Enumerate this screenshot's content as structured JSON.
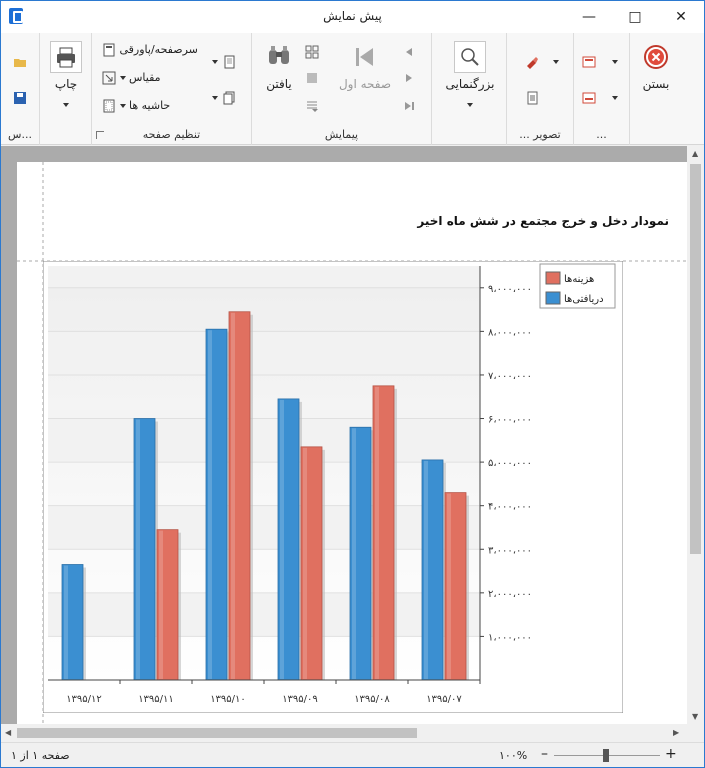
{
  "window": {
    "title": "پیش نمایش"
  },
  "ribbon": {
    "groups": {
      "close": {
        "close_label": "بستن"
      },
      "misc": {
        "label": "..."
      },
      "export": {
        "label": "... تصویر"
      },
      "zoom": {
        "zoom_label": "بزرگنمایی"
      },
      "navigation": {
        "label": "پیمایش",
        "first_page_label": "صفحه اول",
        "find_label": "یافتن"
      },
      "page_setup": {
        "label": "تنظیم صفحه",
        "header_footer_label": "سرصفحه/پاورقی",
        "scale_label": "مقیاس",
        "margins_label": "حاشیه ها"
      },
      "print": {
        "print_label": "چاپ"
      },
      "document": {
        "label": "س..."
      }
    }
  },
  "report": {
    "title": "نمودار دخل و خرج مجتمع در شش ماه اخیر"
  },
  "status": {
    "page_info": "صفحه ۱ از ۱",
    "zoom_value": "۱۰۰%"
  },
  "chart_data": {
    "type": "bar",
    "title": "",
    "xlabel": "",
    "ylabel": "",
    "categories": [
      "۱۳۹۵/۰۷",
      "۱۳۹۵/۰۸",
      "۱۳۹۵/۰۹",
      "۱۳۹۵/۱۰",
      "۱۳۹۵/۱۱",
      "۱۳۹۵/۱۲"
    ],
    "series": [
      {
        "name": "دریافتی‌ها",
        "color": "#3b8fd1",
        "values": [
          5050000,
          5800000,
          6450000,
          8050000,
          6000000,
          2650000
        ]
      },
      {
        "name": "هزینه‌ها",
        "color": "#e07060",
        "values": [
          4300000,
          6750000,
          5350000,
          8450000,
          3450000,
          0
        ]
      }
    ],
    "ylim": [
      0,
      9500000
    ],
    "yticks": [
      1000000,
      2000000,
      3000000,
      4000000,
      5000000,
      6000000,
      7000000,
      8000000,
      9000000
    ],
    "ytick_labels": [
      "۱،۰۰۰،۰۰۰",
      "۲،۰۰۰،۰۰۰",
      "۳،۰۰۰،۰۰۰",
      "۴،۰۰۰،۰۰۰",
      "۵،۰۰۰،۰۰۰",
      "۶،۰۰۰،۰۰۰",
      "۷،۰۰۰،۰۰۰",
      "۸،۰۰۰،۰۰۰",
      "۹،۰۰۰،۰۰۰"
    ],
    "y_axis_side": "right",
    "x_order": "right-to-left",
    "grid": true,
    "legend_position": "top-right"
  }
}
